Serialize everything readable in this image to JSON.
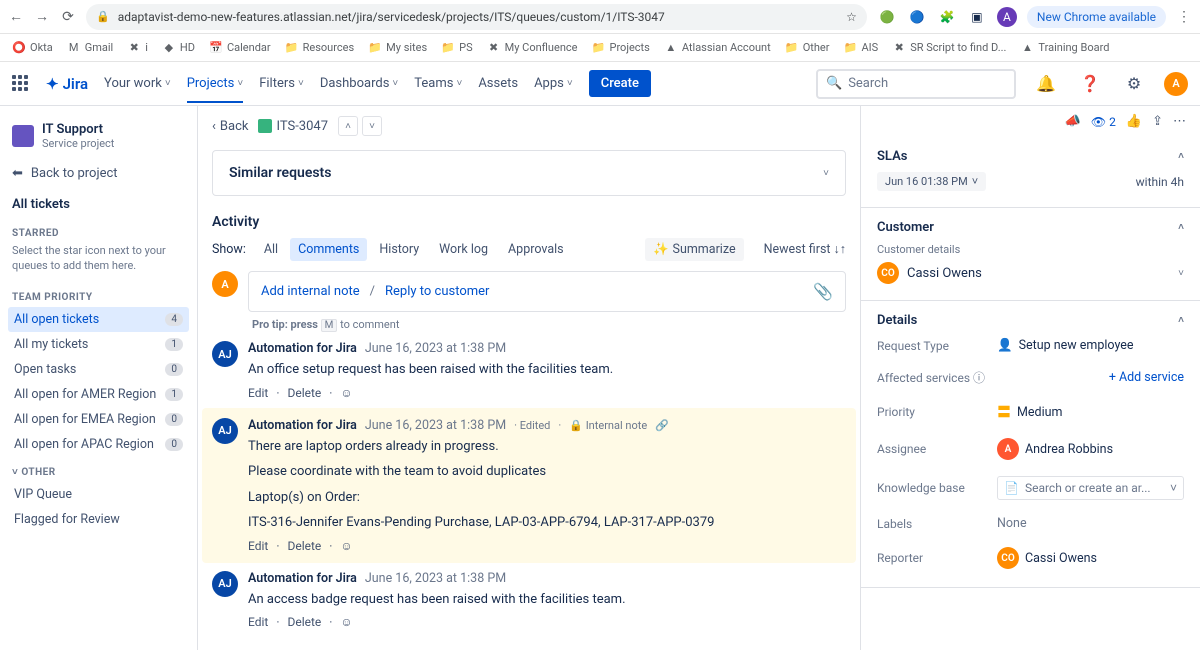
{
  "chrome": {
    "url": "adaptavist-demo-new-features.atlassian.net/jira/servicedesk/projects/ITS/queues/custom/1/ITS-3047",
    "new_btn": "New Chrome available"
  },
  "bookmarks": [
    "Okta",
    "Gmail",
    "i",
    "HD",
    "Calendar",
    "Resources",
    "My sites",
    "PS",
    "My Confluence",
    "Projects",
    "Atlassian Account",
    "Other",
    "AIS",
    "SR Script to find D...",
    "Training Board"
  ],
  "nav": {
    "items": [
      "Your work",
      "Projects",
      "Filters",
      "Dashboards",
      "Teams",
      "Assets",
      "Apps"
    ],
    "create": "Create",
    "search_ph": "Search",
    "logo": "Jira"
  },
  "sidebar": {
    "project": "IT Support",
    "project_sub": "Service project",
    "back": "Back to project",
    "all_tickets": "All tickets",
    "starred": "STARRED",
    "starred_hint": "Select the star icon next to your queues to add them here.",
    "team_priority": "TEAM PRIORITY",
    "queues": [
      {
        "label": "All open tickets",
        "count": "4",
        "sel": true
      },
      {
        "label": "All my tickets",
        "count": "1"
      },
      {
        "label": "Open tasks",
        "count": "0"
      },
      {
        "label": "All open for AMER Region",
        "count": "1"
      },
      {
        "label": "All open for EMEA Region",
        "count": "0"
      },
      {
        "label": "All open for APAC Region",
        "count": "0"
      }
    ],
    "other": "OTHER",
    "other_items": [
      "VIP Queue",
      "Flagged for Review"
    ]
  },
  "crumb": {
    "back": "Back",
    "key": "ITS-3047"
  },
  "similar": "Similar requests",
  "activity": {
    "title": "Activity",
    "show": "Show:",
    "tabs": [
      "All",
      "Comments",
      "History",
      "Work log",
      "Approvals"
    ],
    "summarize": "Summarize",
    "sort": "Newest first",
    "add_note": "Add internal note",
    "reply": "Reply to customer",
    "tip_pre": "Pro tip: press",
    "tip_key": "M",
    "tip_post": "to comment"
  },
  "comments": [
    {
      "author": "Automation for Jira",
      "date": "June 16, 2023 at 1:38 PM",
      "text": "An office setup request has been raised with the facilities team.",
      "internal": false
    },
    {
      "author": "Automation for Jira",
      "date": "June 16, 2023 at 1:38 PM",
      "edited": "Edited",
      "tag": "Internal note",
      "internal": true,
      "lines": [
        "There are laptop orders already in progress.",
        "Please coordinate with the team to avoid duplicates",
        "Laptop(s) on Order:",
        "ITS-316-Jennifer Evans-Pending Purchase, LAP-03-APP-6794, LAP-317-APP-0379"
      ]
    },
    {
      "author": "Automation for Jira",
      "date": "June 16, 2023 at 1:38 PM",
      "text": "An access badge request has been raised with the facilities team.",
      "internal": false
    }
  ],
  "actions": {
    "edit": "Edit",
    "delete": "Delete"
  },
  "right": {
    "views": "2",
    "slas": {
      "title": "SLAs",
      "date": "Jun 16 01:38 PM",
      "within": "within 4h"
    },
    "customer": {
      "title": "Customer",
      "label": "Customer details",
      "name": "Cassi Owens",
      "initials": "CO"
    },
    "details": {
      "title": "Details",
      "request_type": {
        "label": "Request Type",
        "value": "Setup new employee"
      },
      "affected": {
        "label": "Affected services",
        "add": "Add service"
      },
      "priority": {
        "label": "Priority",
        "value": "Medium"
      },
      "assignee": {
        "label": "Assignee",
        "value": "Andrea Robbins"
      },
      "kb": {
        "label": "Knowledge base",
        "ph": "Search or create an ar..."
      },
      "labels": {
        "label": "Labels",
        "value": "None"
      },
      "reporter": {
        "label": "Reporter",
        "value": "Cassi Owens",
        "initials": "CO"
      }
    }
  }
}
